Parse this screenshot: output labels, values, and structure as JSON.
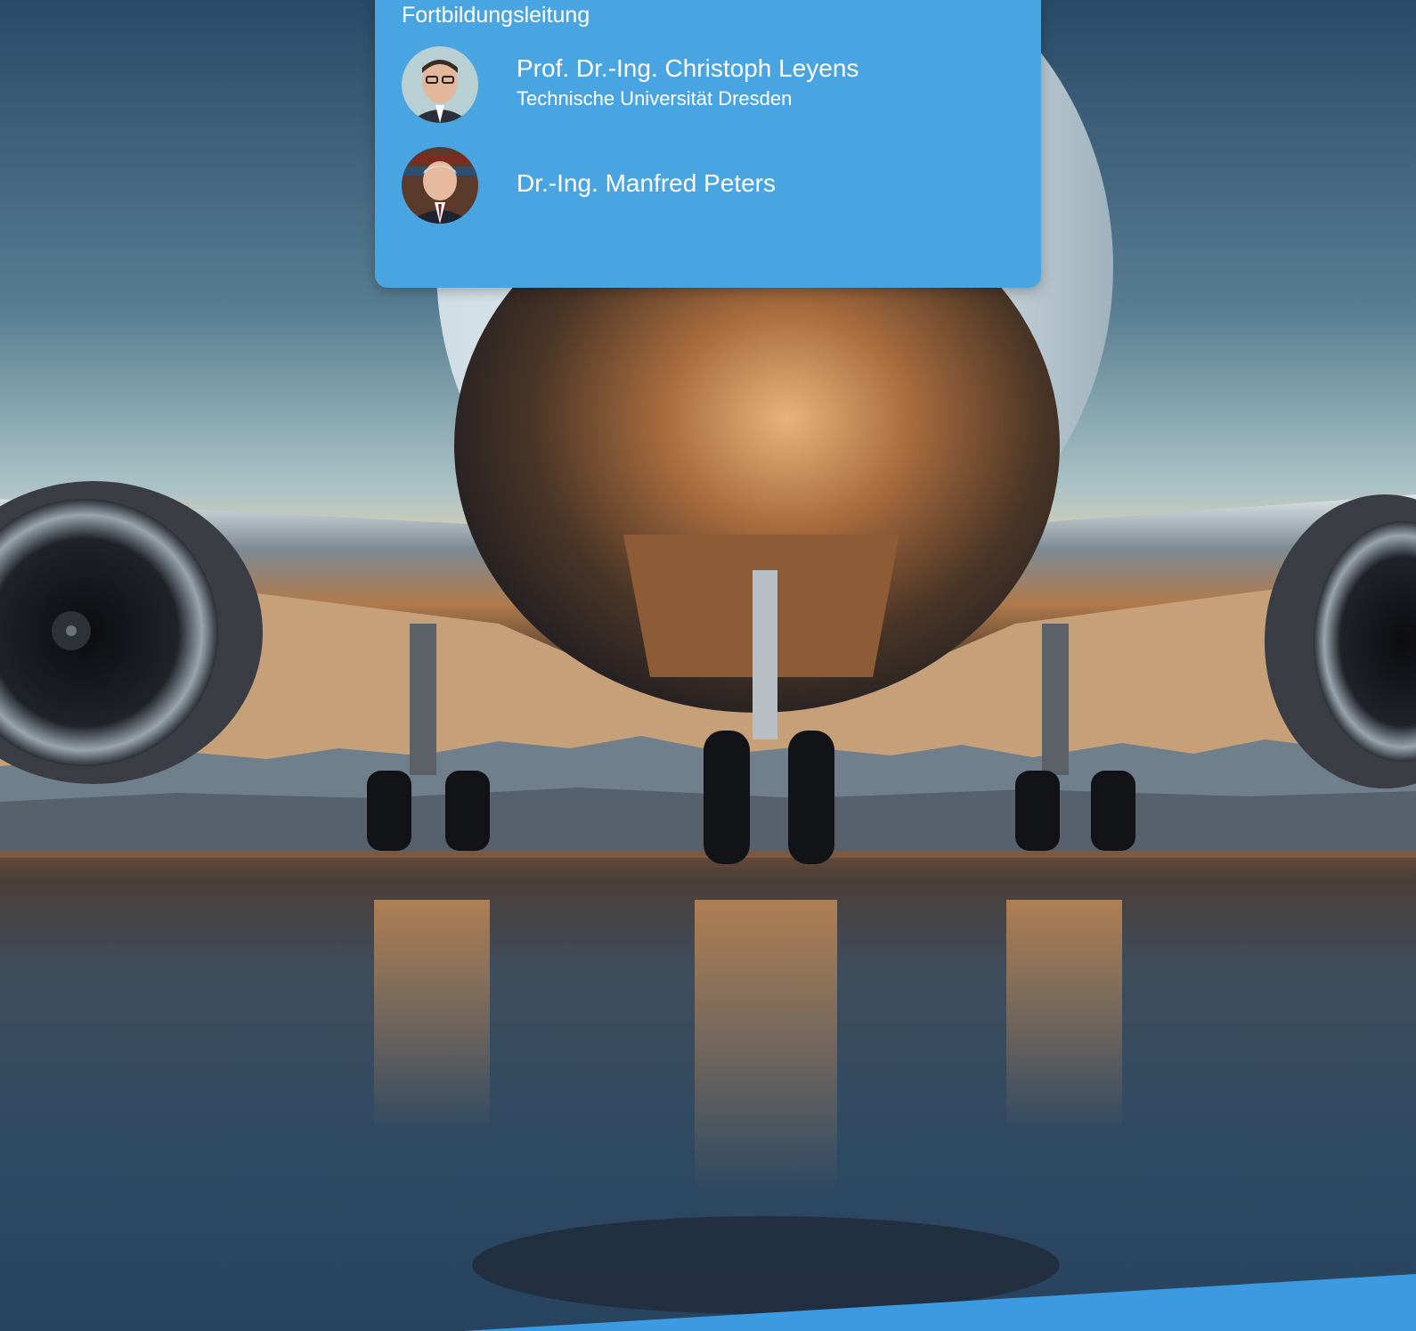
{
  "card": {
    "heading": "Fortbildungsleitung",
    "people": [
      {
        "name": "Prof. Dr.-Ing. Christoph Leyens",
        "affiliation": "Technische Universität Dresden",
        "avatar_icon": "person-portrait-icon"
      },
      {
        "name": "Dr.-Ing. Manfred Peters",
        "avatar_icon": "person-portrait-icon"
      }
    ]
  },
  "colors": {
    "card_background": "#48a5e2",
    "card_text": "#ffffff",
    "bottom_stripe": "#3c9ae0"
  }
}
